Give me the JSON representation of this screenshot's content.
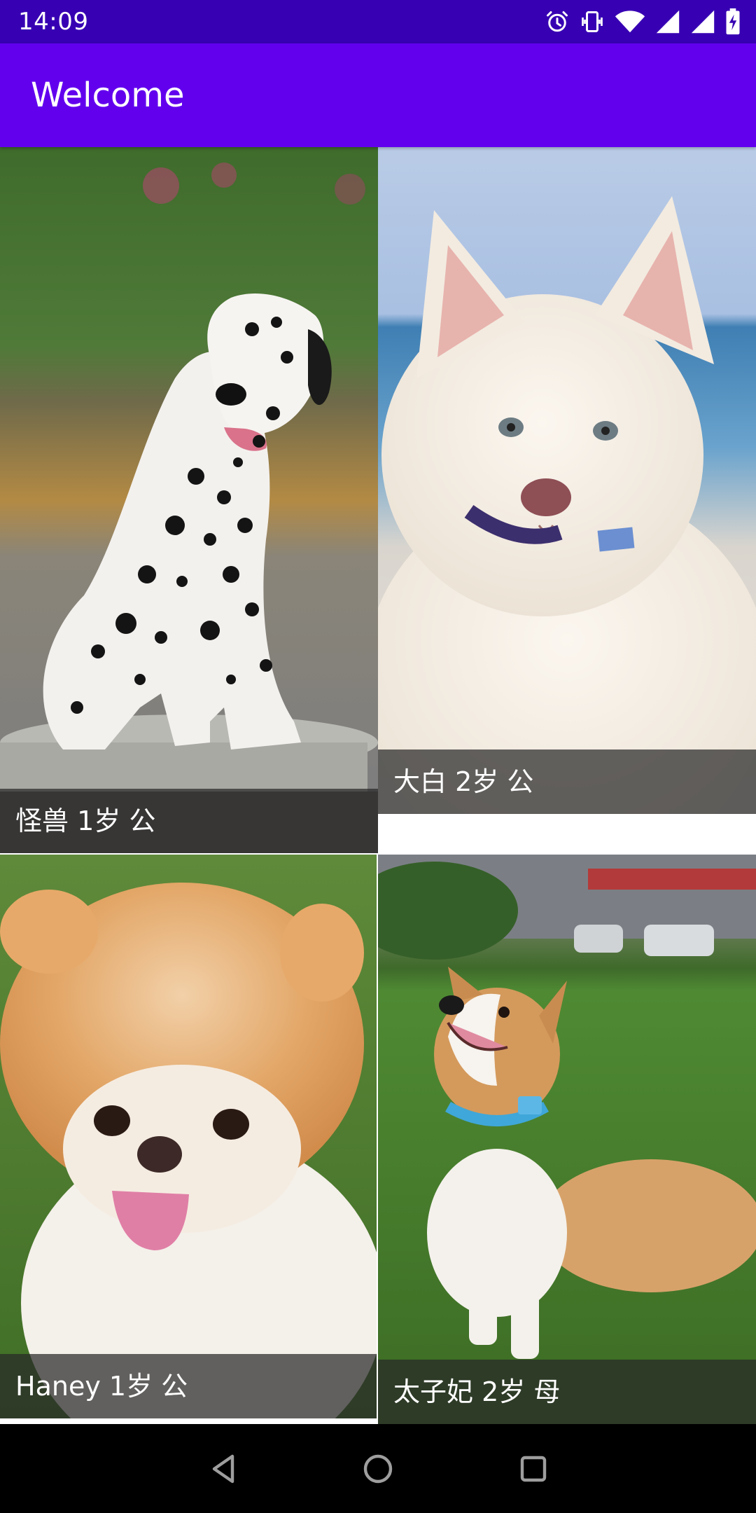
{
  "status_bar": {
    "time": "14:09",
    "icons": [
      "alarm-icon",
      "vibrate-icon",
      "wifi-icon",
      "signal-icon",
      "signal-icon",
      "battery-charging-icon"
    ]
  },
  "app_bar": {
    "title": "Welcome"
  },
  "dogs": [
    {
      "caption": "怪兽 1岁 公",
      "image": "dalmatian-photo"
    },
    {
      "caption": "大白 2岁 公",
      "image": "white-samoyed-puppy-photo"
    },
    {
      "caption": "Haney 1岁 公",
      "image": "pomeranian-photo"
    },
    {
      "caption": "太子妃 2岁 母",
      "image": "corgi-photo"
    }
  ],
  "nav_bar": {
    "buttons": [
      "back-icon",
      "home-icon",
      "recents-icon"
    ]
  },
  "colors": {
    "status_bar": "#3700b3",
    "app_bar": "#6200ee",
    "nav_bar": "#000000"
  }
}
